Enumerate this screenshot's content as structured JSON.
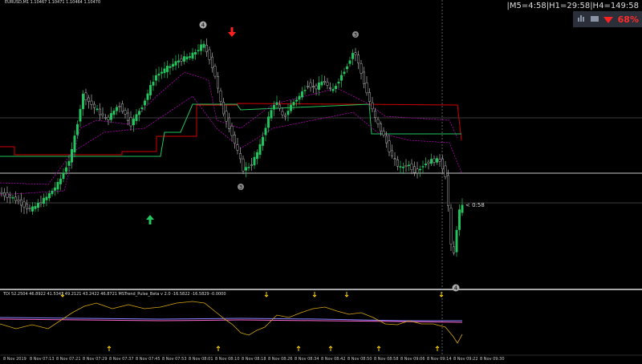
{
  "header": {
    "symbol_info": "EURUSD,M1  1.10467 1.10471 1.10464 1.10470"
  },
  "timer": {
    "text": "|M5=4:58|H1=29:58|H4=149:58"
  },
  "signal_panel": {
    "percent": "68%",
    "icons": [
      "bar-chart-icon",
      "monitor-icon",
      "down-arrow-icon"
    ]
  },
  "current_label": "< 0:58",
  "indicator_header": "TDI 52.2504 46.8922 41.5341 49.2121 43.2422 46.8721  MSTrend_Pulse_Beta  v 2.0 -16.5822 -16.5829 -0.0000",
  "wave_labels": [
    "4",
    "3",
    "3",
    "4"
  ],
  "x_axis_ticks": [
    "8 Nov 2019",
    "8 Nov 07:13",
    "8 Nov 07:21",
    "8 Nov 07:29",
    "8 Nov 07:37",
    "8 Nov 07:45",
    "8 Nov 07:53",
    "8 Nov 08:01",
    "8 Nov 08:10",
    "8 Nov 08:18",
    "8 Nov 08:26",
    "8 Nov 08:34",
    "8 Nov 08:42",
    "8 Nov 08:50",
    "8 Nov 08:58",
    "8 Nov 09:06",
    "8 Nov 09:14",
    "8 Nov 09:22",
    "8 Nov 09:30"
  ],
  "colors": {
    "bull_candle": "#22c55e",
    "bear_candle": "#b0b0b0",
    "red_line": "#d00000",
    "green_line": "#22c55e",
    "magenta_line": "#b000b0",
    "tdi_yellow": "#d4a514",
    "tdi_pink": "#ff66cc",
    "tdi_blue": "#8080ff",
    "arrow_yellow": "#ffd400",
    "arrow_red": "#ff2020",
    "arrow_green": "#22c55e"
  }
}
